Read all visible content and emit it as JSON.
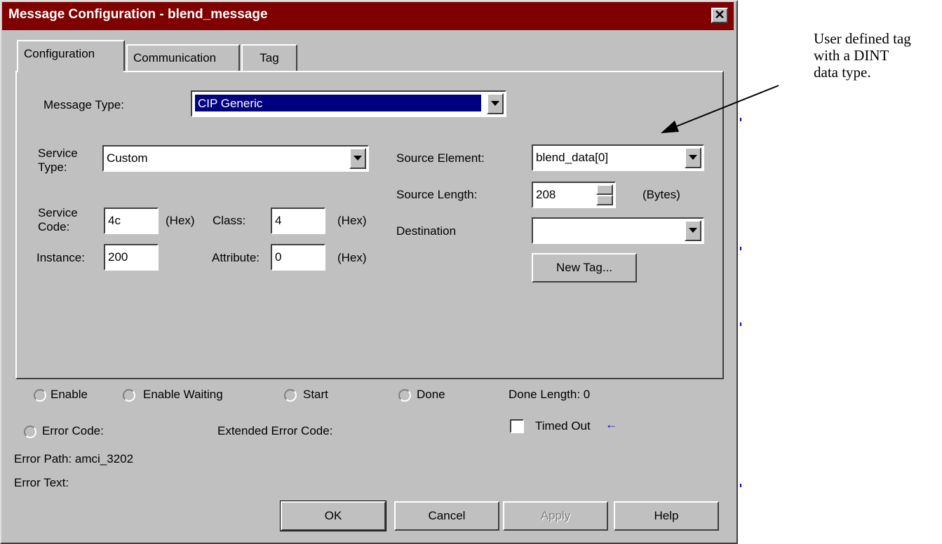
{
  "window": {
    "title": "Message Configuration - blend_message",
    "close_glyph": "✕"
  },
  "tabs": [
    {
      "label": "Configuration",
      "active": true
    },
    {
      "label": "Communication",
      "active": false
    },
    {
      "label": "Tag",
      "active": false
    }
  ],
  "config": {
    "message_type_label": "Message Type:",
    "message_type_value": "CIP Generic",
    "service_type_label_1": "Service",
    "service_type_label_2": "Type:",
    "service_type_value": "Custom",
    "service_code_label_1": "Service",
    "service_code_label_2": "Code:",
    "service_code_value": "4c",
    "hex": "(Hex)",
    "class_label": "Class:",
    "class_value": "4",
    "instance_label": "Instance:",
    "instance_value": "200",
    "attribute_label": "Attribute:",
    "attribute_value": "0",
    "source_element_label": "Source Element:",
    "source_element_value": "blend_data[0]",
    "source_length_label": "Source Length:",
    "source_length_value": "208",
    "bytes_label": "(Bytes)",
    "destination_label": "Destination",
    "destination_value": "",
    "new_tag_label": "New Tag..."
  },
  "status": {
    "enable": "Enable",
    "enable_waiting": "Enable Waiting",
    "start": "Start",
    "done": "Done",
    "done_length": "Done Length: 0",
    "error_code": "Error Code:",
    "extended_error_code": "Extended Error Code:",
    "timed_out": "Timed Out",
    "timed_out_arrow": "←",
    "error_path": "Error Path: amci_3202",
    "error_text": "Error Text:"
  },
  "buttons": {
    "ok": "OK",
    "cancel": "Cancel",
    "apply": "Apply",
    "help": "Help"
  },
  "annotation": {
    "line1": "User defined tag",
    "line2": "with a DINT",
    "line3": "data type."
  },
  "colors": {
    "title_bar": "#800000",
    "selected_field": "#000080",
    "dialog_face": "#c0c0c0",
    "arrow_accent": "#0000cc"
  }
}
